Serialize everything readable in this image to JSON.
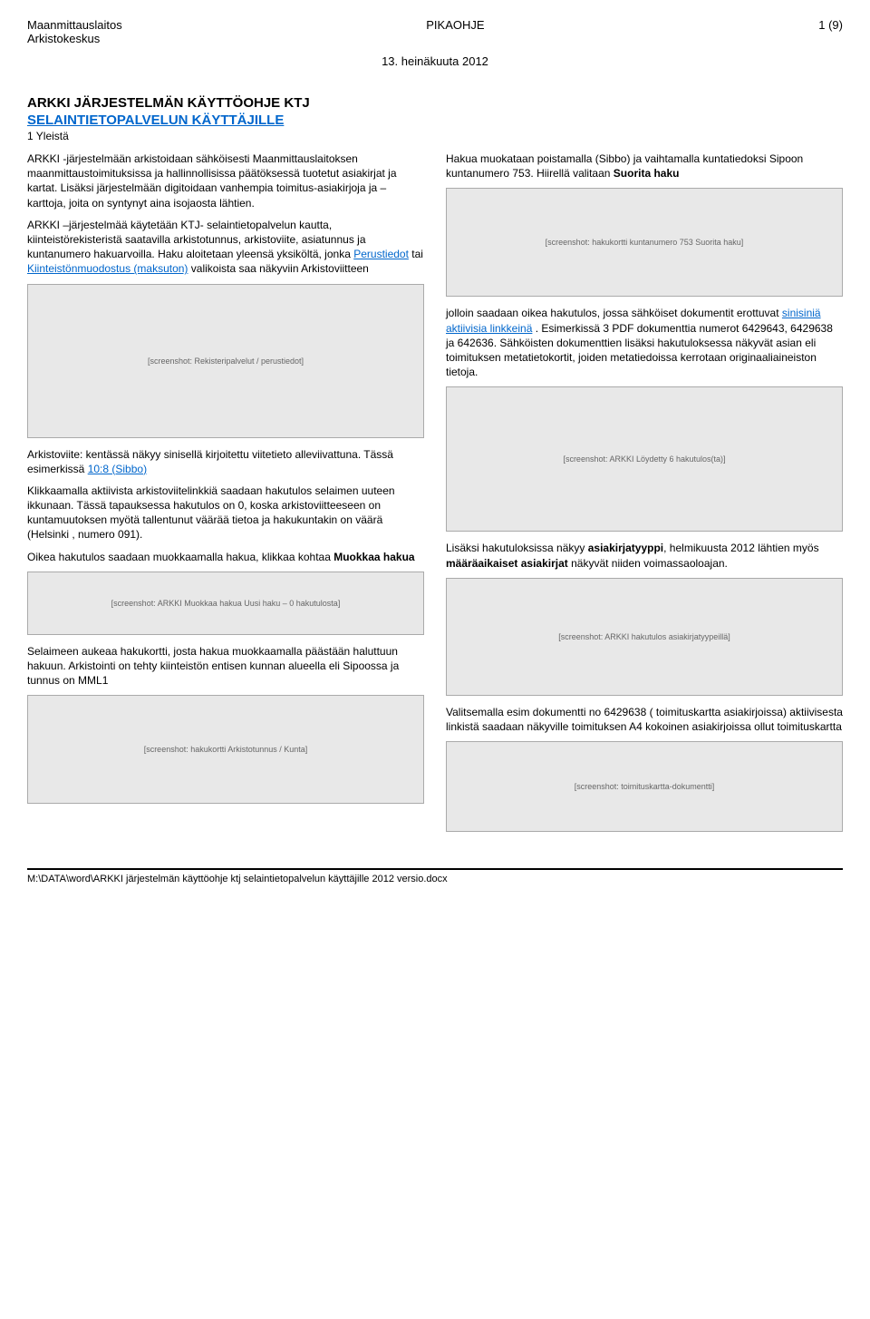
{
  "header": {
    "org": "Maanmittauslaitos",
    "unit": "Arkistokeskus",
    "doctype": "PIKAOHJE",
    "pageinfo": "1 (9)",
    "date": "13. heinäkuuta 2012"
  },
  "title": "ARKKI JÄRJESTELMÄN KÄYTTÖOHJE KTJ",
  "subtitle": "SELAINTIETOPALVELUN KÄYTTÄJILLE",
  "section_heading": "1 Yleistä",
  "left": {
    "p1a": "ARKKI -järjestelmään arkistoidaan sähköisesti Maanmittauslaitoksen maanmittaustoimituksissa ja hallinnollisissa päätöksessä tuotetut asiakirjat ja kartat. Lisäksi järjestelmään digitoidaan vanhempia toimitus-asiakirjoja ja –karttoja, joita on syntynyt aina isojaosta lähtien.",
    "p1b_pre": "ARKKI –järjestelmää käytetään KTJ- selaintietopalvelun kautta, kiinteistörekisteristä saatavilla arkistotunnus, arkistoviite, asiatunnus ja kuntanumero hakuarvoilla. Haku aloitetaan yleensä yksiköltä, jonka ",
    "p1b_link1": "Perustiedot",
    "p1b_mid": " tai ",
    "p1b_link2": "Kiinteistönmuodostus (maksuton)",
    "p1b_post": " valikoista saa näkyviin Arkistoviitteen",
    "p2_pre": "Arkistoviite: kentässä näkyy sinisellä kirjoitettu viitetieto alleviivattuna. Tässä esimerkissä ",
    "p2_link": "10:8 (Sibbo)",
    "p3": "Klikkaamalla aktiivista arkistoviitelinkkiä saadaan hakutulos selaimen uuteen ikkunaan. Tässä tapauksessa hakutulos on 0, koska arkistoviitteeseen on kuntamuutoksen myötä tallentunut väärää tietoa ja hakukuntakin on väärä (Helsinki , numero 091).",
    "p4": "Oikea hakutulos saadaan muokkaamalla hakua, klikkaa kohtaa ",
    "p4_bold": "Muokkaa hakua",
    "p5": "Selaimeen aukeaa hakukortti, josta hakua muokkaamalla päästään haluttuun hakuun. Arkistointi on tehty kiinteistön entisen kunnan alueella eli Sipoossa ja tunnus on MML1"
  },
  "right": {
    "p1_pre": "Hakua muokataan poistamalla (Sibbo) ja vaihtamalla kuntatiedoksi Sipoon kuntanumero 753. Hiirellä valitaan ",
    "p1_bold": "Suorita haku",
    "p2_pre": "jolloin saadaan oikea hakutulos, jossa sähköiset dokumentit erottuvat ",
    "p2_link": "sinisiniä aktiivisia linkkeinä",
    "p2_post": ". Esimerkissä 3 PDF dokumenttia numerot 6429643, 6429638 ja 642636. Sähköisten dokumenttien lisäksi hakutuloksessa näkyvät asian eli toimituksen metatietokortit, joiden metatiedoissa kerrotaan originaaliaineiston tietoja.",
    "p3_pre": "Lisäksi hakutuloksissa näkyy ",
    "p3_b1": "asiakirjatyyppi",
    "p3_mid": ", helmikuusta 2012 lähtien myös ",
    "p3_b2": "määräaikaiset asiakirjat",
    "p3_post": " näkyvät niiden voimassaoloajan.",
    "p4": "Valitsemalla esim dokumentti no 6429638 ( toimituskartta asiakirjoissa) aktiivisesta linkistä saadaan näkyville toimituksen A4 kokoinen asiakirjoissa ollut toimituskartta"
  },
  "placeholders": {
    "img1": "[screenshot: Rekisteripalvelut / perustiedot]",
    "img2": "[screenshot: ARKKI Muokkaa hakua Uusi haku – 0 hakutulosta]",
    "img3": "[screenshot: hakukortti Arkistotunnus / Kunta]",
    "img4": "[screenshot: hakukortti kuntanumero 753 Suorita haku]",
    "img5": "[screenshot: ARKKI Löydetty 6 hakutulos(ta)]",
    "img6": "[screenshot: ARKKI hakutulos asiakirjatyypeillä]",
    "img7": "[screenshot: toimituskartta-dokumentti]"
  },
  "footer": {
    "path": "M:\\DATA\\word\\ARKKI järjestelmän käyttöohje ktj selaintietopalvelun käyttäjille 2012 versio.docx"
  }
}
